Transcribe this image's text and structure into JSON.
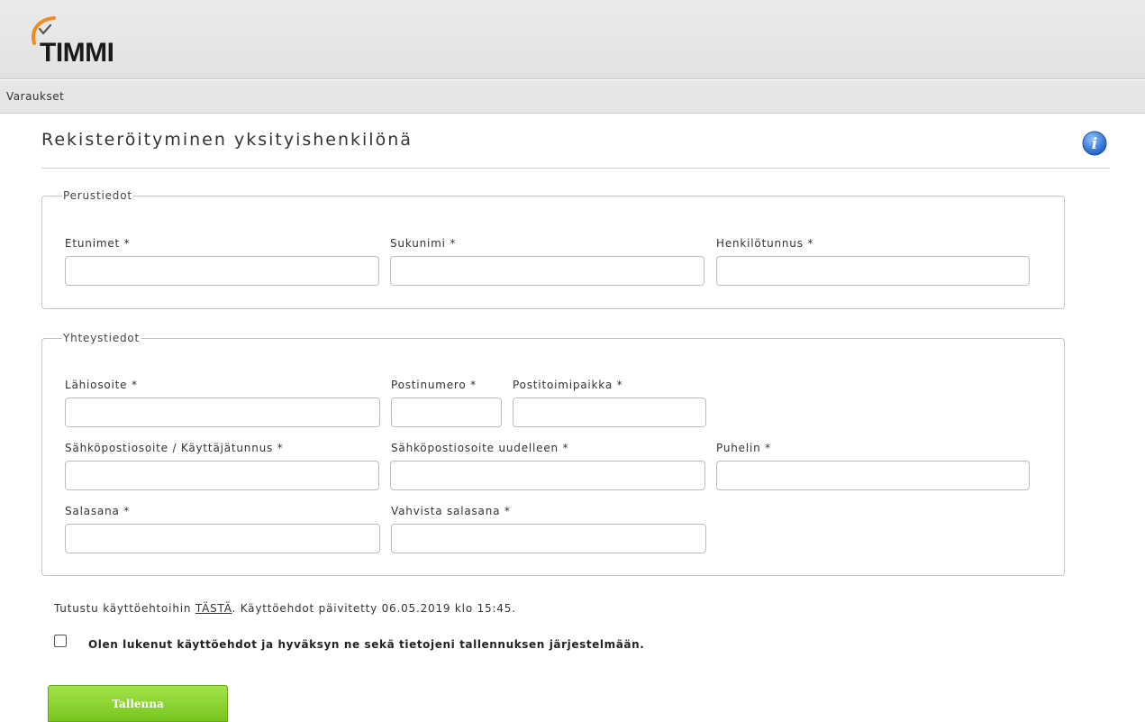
{
  "app": {
    "logo_text": "TIMMI",
    "logo_icon": "orange-checkmark-arc-icon"
  },
  "nav": {
    "items": [
      {
        "label": "Varaukset"
      }
    ]
  },
  "page": {
    "title": "Rekisteröityminen yksityishenkilönä",
    "info_icon": "info-icon"
  },
  "basic_info": {
    "legend": "Perustiedot",
    "first_names": {
      "label": "Etunimet *",
      "value": ""
    },
    "last_name": {
      "label": "Sukunimi *",
      "value": ""
    },
    "ssn": {
      "label": "Henkilötunnus *",
      "value": ""
    }
  },
  "contact_info": {
    "legend": "Yhteystiedot",
    "street_address": {
      "label": "Lähiosoite *",
      "value": ""
    },
    "postal_code": {
      "label": "Postinumero *",
      "value": ""
    },
    "city": {
      "label": "Postitoimipaikka *",
      "value": ""
    },
    "email_username": {
      "label": "Sähköpostiosoite / Käyttäjätunnus *",
      "value": ""
    },
    "email_confirm": {
      "label": "Sähköpostiosoite uudelleen *",
      "value": ""
    },
    "phone": {
      "label": "Puhelin *",
      "value": ""
    },
    "password": {
      "label": "Salasana *",
      "value": ""
    },
    "password_confirm": {
      "label": "Vahvista salasana *",
      "value": ""
    }
  },
  "terms": {
    "prefix": "Tutustu käyttöehtoihin ",
    "link": "TÄSTÄ",
    "suffix": ". Käyttöehdot päivitetty 06.05.2019 klo 15:45.",
    "accept_label": "Olen lukenut käyttöehdot ja hyväksyn ne sekä tietojeni tallennuksen järjestelmään.",
    "accepted": false
  },
  "actions": {
    "save_label": "Tallenna"
  },
  "colors": {
    "accent_green": "#8ad431",
    "info_blue": "#2f72d4",
    "logo_orange": "#f08c1e"
  }
}
